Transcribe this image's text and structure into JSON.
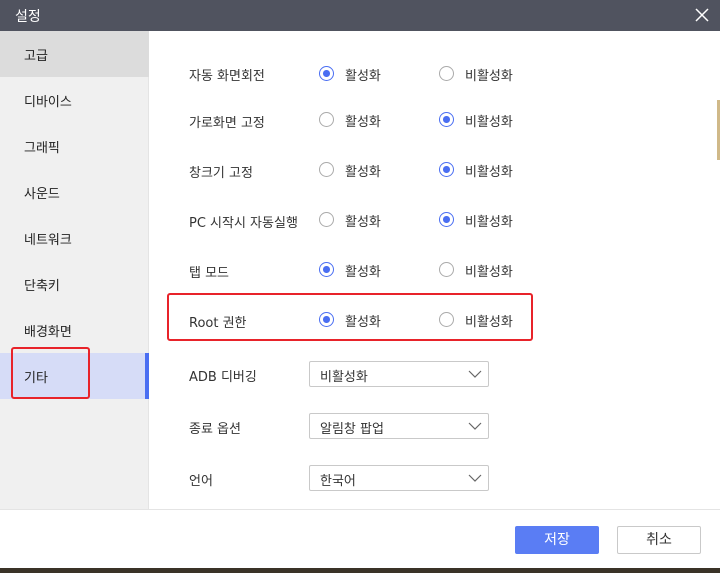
{
  "window": {
    "title": "설정"
  },
  "sidebar": {
    "items": [
      {
        "label": "고급"
      },
      {
        "label": "디바이스"
      },
      {
        "label": "그래픽"
      },
      {
        "label": "사운드"
      },
      {
        "label": "네트워크"
      },
      {
        "label": "단축키"
      },
      {
        "label": "배경화면"
      },
      {
        "label": "기타"
      }
    ],
    "active_index": 7
  },
  "settings": {
    "rows": [
      {
        "label": "자동 화면회전",
        "on": "활성화",
        "off": "비활성화",
        "selected": "on"
      },
      {
        "label": "가로화면 고정",
        "on": "활성화",
        "off": "비활성화",
        "selected": "off"
      },
      {
        "label": "창크기 고정",
        "on": "활성화",
        "off": "비활성화",
        "selected": "off"
      },
      {
        "label": "PC 시작시 자동실행",
        "on": "활성화",
        "off": "비활성화",
        "selected": "off"
      },
      {
        "label": "탭 모드",
        "on": "활성화",
        "off": "비활성화",
        "selected": "on"
      },
      {
        "label": "Root 권한",
        "on": "활성화",
        "off": "비활성화",
        "selected": "on"
      }
    ],
    "dropdowns": [
      {
        "label": "ADB 디버깅",
        "value": "비활성화"
      },
      {
        "label": "종료 옵션",
        "value": "알림창 팝업"
      },
      {
        "label": "언어",
        "value": "한국어"
      }
    ]
  },
  "footer": {
    "save_label": "저장",
    "cancel_label": "취소"
  },
  "colors": {
    "accent": "#4a6ef2",
    "highlight": "#e8232a",
    "titlebar": "#50535f"
  }
}
